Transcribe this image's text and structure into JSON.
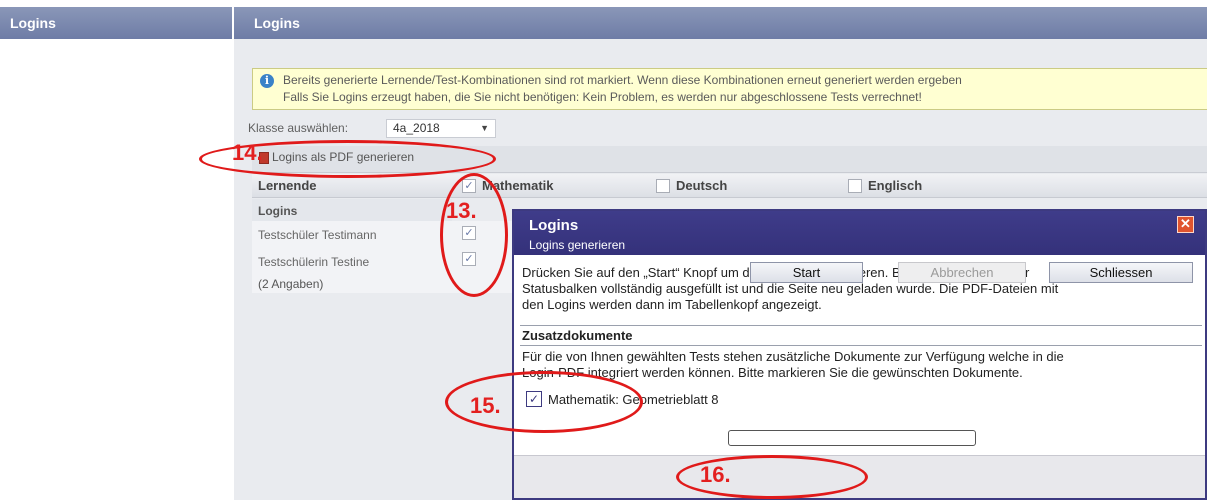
{
  "left_panel": {
    "title": "Logins"
  },
  "main_header": {
    "title": "Logins"
  },
  "info": {
    "line1": "Bereits generierte Lernende/Test-Kombinationen sind rot markiert. Wenn diese Kombinationen erneut generiert werden ergeben",
    "line2": "Falls Sie Logins erzeugt haben, die Sie nicht benötigen: Kein Problem, es werden nur abgeschlossene Tests verrechnet!"
  },
  "class_select": {
    "label": "Klasse auswählen:",
    "value": "4a_2018"
  },
  "pdf_button": {
    "label": "Logins als PDF generieren"
  },
  "table": {
    "col_lernende": "Lernende",
    "tests": [
      {
        "name": "Mathematik",
        "checked": true
      },
      {
        "name": "Deutsch",
        "checked": false
      },
      {
        "name": "Englisch",
        "checked": false
      }
    ],
    "group_label": "Logins",
    "rows": [
      {
        "name": "Testschüler Testimann",
        "checked": true
      },
      {
        "name": "Testschülerin Testine",
        "checked": true
      }
    ],
    "summary": "(2 Angaben)"
  },
  "dialog": {
    "title": "Logins",
    "subtitle": "Logins generieren",
    "close_icon": "close-icon",
    "text1": "Drücken Sie auf den „Start“ Knopf um die Logins zu generieren. Bitte warten Sie, bis der",
    "text2": "Statusbalken vollständig ausgefüllt ist und die Seite neu geladen wurde. Die PDF-Dateien mit",
    "text3": "den Logins werden dann im Tabellenkopf angezeigt.",
    "section_title": "Zusatzdokumente",
    "section_text1": "Für die von Ihnen gewählten Tests stehen zusätzliche Dokumente zur Verfügung welche in die",
    "section_text2": "Login-PDF integriert werden können. Bitte markieren Sie die gewünschten Dokumente.",
    "extra_doc": {
      "label": "Mathematik: Geometrieblatt 8",
      "checked": true
    },
    "progress": 0,
    "buttons": {
      "start": "Start",
      "cancel": "Abbrechen",
      "close": "Schliessen"
    }
  },
  "annotations": {
    "step13": "13.",
    "step14": "14.",
    "step15": "15.",
    "step16": "16.",
    "color": "#e01a1a"
  }
}
